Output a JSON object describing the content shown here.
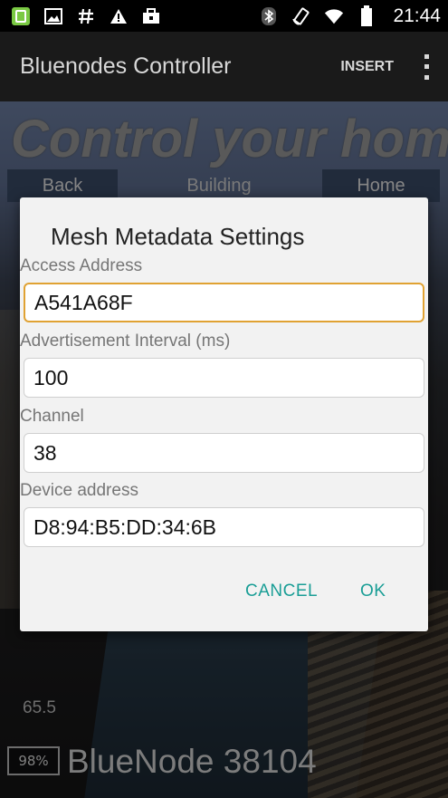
{
  "status_bar": {
    "left_icons": [
      "app-notification-icon",
      "image-icon",
      "hash-icon",
      "warning-icon",
      "briefcase-icon"
    ],
    "right_icons": [
      "bluetooth-icon",
      "rotate-icon",
      "wifi-icon",
      "battery-icon"
    ],
    "time": "21:44"
  },
  "action_bar": {
    "title": "Bluenodes Controller",
    "insert_label": "INSERT"
  },
  "background": {
    "hero_text": "Control your home",
    "nav_back": "Back",
    "nav_building": "Building",
    "nav_home": "Home",
    "temperature": "65.5",
    "battery": "98%",
    "node_name": "BlueNode 38104"
  },
  "dialog": {
    "title": "Mesh Metadata Settings",
    "fields": [
      {
        "label": "Access Address",
        "value": "A541A68F"
      },
      {
        "label": "Advertisement Interval (ms)",
        "value": "100"
      },
      {
        "label": "Channel",
        "value": "38"
      },
      {
        "label": "Device address",
        "value": "D8:94:B5:DD:34:6B"
      }
    ],
    "cancel_label": "CANCEL",
    "ok_label": "OK"
  },
  "colors": {
    "accent": "#1a9e96",
    "focus_border": "#e0a233",
    "action_bar": "#1a1a1a"
  }
}
